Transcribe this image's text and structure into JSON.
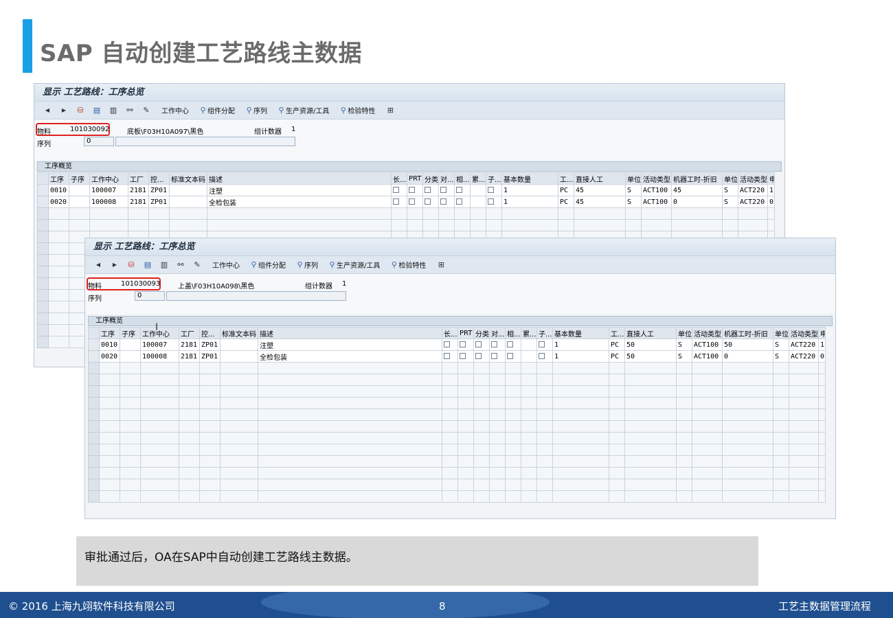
{
  "slide": {
    "title": "SAP 自动创建工艺路线主数据",
    "caption": "审批通过后，OA在SAP中自动创建工艺路线主数据。",
    "footer_copyright": "© 2016 上海九翊软件科技有限公司",
    "page_number": "8",
    "footer_title": "工艺主数据管理流程",
    "accent_color": "#1aa0e6",
    "footer_color": "#1f4f8f"
  },
  "toolbar": {
    "work_center": "工作中心",
    "component_alloc": "组件分配",
    "sequence": "序列",
    "prt": "生产资源/工具",
    "inspection": "检验特性"
  },
  "grid_headers": [
    "工序",
    "子序",
    "工作中心",
    "工厂",
    "控...",
    "标准文本码",
    "描述",
    "长...",
    "PRT",
    "分类",
    "对...",
    "相...",
    "累...",
    "子...",
    "基本数量",
    "工...",
    "直接人工",
    "单位",
    "活动类型",
    "机器工时-折旧",
    "单位",
    "活动类型",
    "申"
  ],
  "windows": [
    {
      "title": "显示 工艺路线：工序总览",
      "material_label": "物料",
      "material": "101030092",
      "material_desc": "底板\\F03H10A097\\黑色",
      "counter_label": "组计数器",
      "counter": "1",
      "sequence_label": "序列",
      "sequence": "0",
      "section_title": "工序概览",
      "rows": [
        [
          "0010",
          "",
          "100007",
          "2181",
          "ZP01",
          "",
          "注塑",
          "1",
          "PC",
          "45",
          "S",
          "ACT100",
          "45",
          "S",
          "ACT220",
          "1"
        ],
        [
          "0020",
          "",
          "100008",
          "2181",
          "ZP01",
          "",
          "全检包装",
          "1",
          "PC",
          "45",
          "S",
          "ACT100",
          "0",
          "S",
          "ACT220",
          "0"
        ]
      ]
    },
    {
      "title": "显示 工艺路线：工序总览",
      "material_label": "物料",
      "material": "101030093",
      "material_desc": "上盖\\F03H10A098\\黑色",
      "counter_label": "组计数器",
      "counter": "1",
      "sequence_label": "序列",
      "sequence": "0",
      "section_title": "工序概览",
      "rows": [
        [
          "0010",
          "",
          "100007",
          "2181",
          "ZP01",
          "",
          "注塑",
          "1",
          "PC",
          "50",
          "S",
          "ACT100",
          "50",
          "S",
          "ACT220",
          "1"
        ],
        [
          "0020",
          "",
          "100008",
          "2181",
          "ZP01",
          "",
          "全检包装",
          "1",
          "PC",
          "50",
          "S",
          "ACT100",
          "0",
          "S",
          "ACT220",
          "0"
        ]
      ]
    }
  ]
}
